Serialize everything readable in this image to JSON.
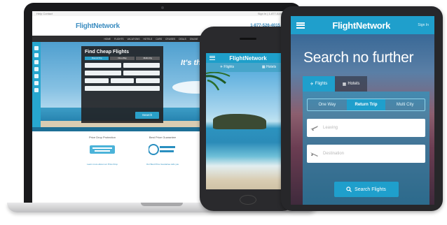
{
  "laptop_site": {
    "topbar_left": "Help  Contact",
    "topbar_right": "Sign In  |  1-877-526-4015",
    "logo": "FlightNetwork",
    "phone": "1-877-526-4015",
    "nav": [
      "HOME",
      "FLIGHTS",
      "VACATIONS",
      "HOTELS",
      "CARS",
      "CRUISES",
      "DEALS",
      "ONLINE",
      "GET TRAVEL INFO"
    ],
    "form": {
      "title": "Find Cheap Flights",
      "tabs": [
        "Round-Trip",
        "One-Way",
        "Multi-City"
      ],
      "search": "Search"
    },
    "tagline": "It's the pr...",
    "features": [
      {
        "title": "Price Drop Protection",
        "caption": "Learn more about our Price Drop"
      },
      {
        "title": "Best Price Guarantee",
        "caption": "Our Best Price Guarantee tells you"
      },
      {
        "title": "Price Ticket",
        "caption": "Flight itineraries and fare alerts"
      }
    ]
  },
  "phone_app": {
    "logo": "FlightNetwork",
    "tabs": [
      "Flights",
      "Hotels"
    ]
  },
  "tablet_app": {
    "logo": "FlightNetwork",
    "sign_in": "Sign In",
    "heading": "Search no further",
    "tabs": [
      "Flights",
      "Hotels"
    ],
    "trip_types": [
      "One Way",
      "Return Trip",
      "Multi City"
    ],
    "selected_trip_type": "Return Trip",
    "leaving_placeholder": "Leaving",
    "destination_placeholder": "Destination",
    "search_button": "Search Flights"
  },
  "colors": {
    "brand_blue": "#1f9fcc"
  }
}
